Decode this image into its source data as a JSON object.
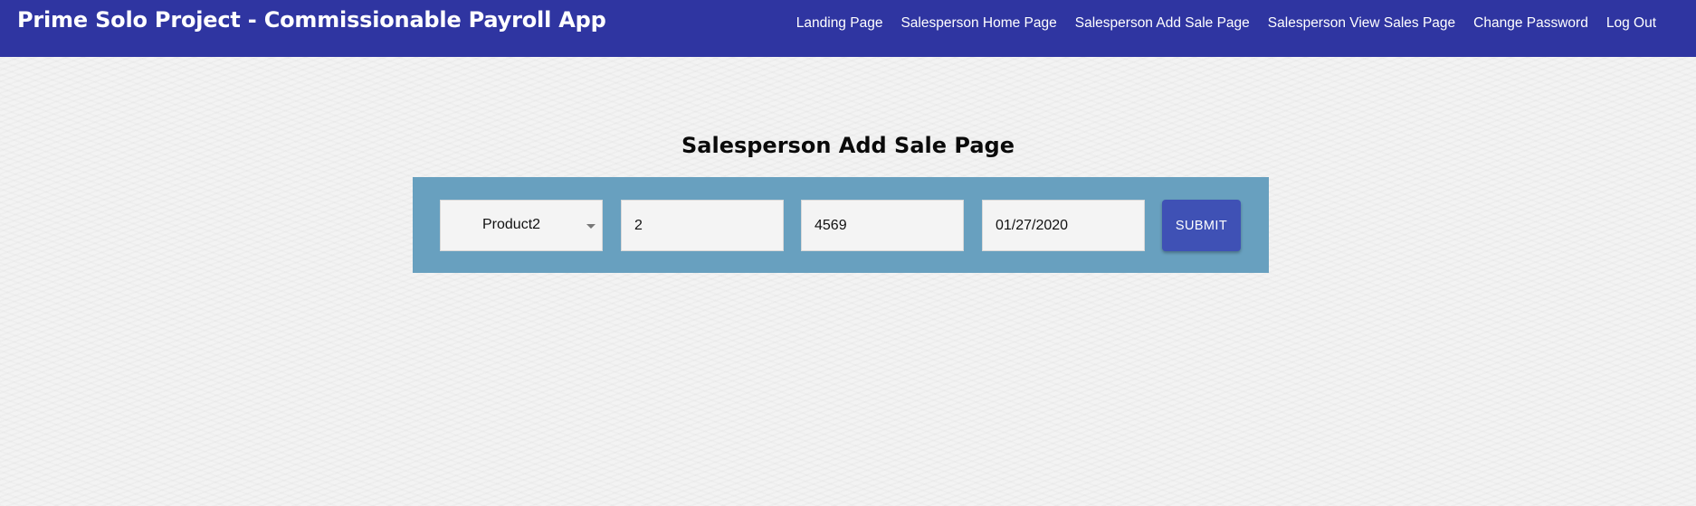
{
  "header": {
    "title": "Prime Solo Project - Commissionable Payroll App",
    "nav": [
      {
        "label": "Landing Page"
      },
      {
        "label": "Salesperson Home Page"
      },
      {
        "label": "Salesperson Add Sale Page"
      },
      {
        "label": "Salesperson View Sales Page"
      },
      {
        "label": "Change Password"
      },
      {
        "label": "Log Out"
      }
    ],
    "bg_color": "#2f35a1"
  },
  "main": {
    "heading": "Salesperson Add Sale Page",
    "form": {
      "product_select": {
        "value": "Product2",
        "icon": "caret-down-icon"
      },
      "quantity": {
        "value": "2"
      },
      "amount": {
        "value": "4569"
      },
      "date": {
        "value": "01/27/2020"
      },
      "submit_label": "SUBMIT",
      "panel_color": "#68a0bf",
      "button_color": "#3f51b5"
    }
  }
}
